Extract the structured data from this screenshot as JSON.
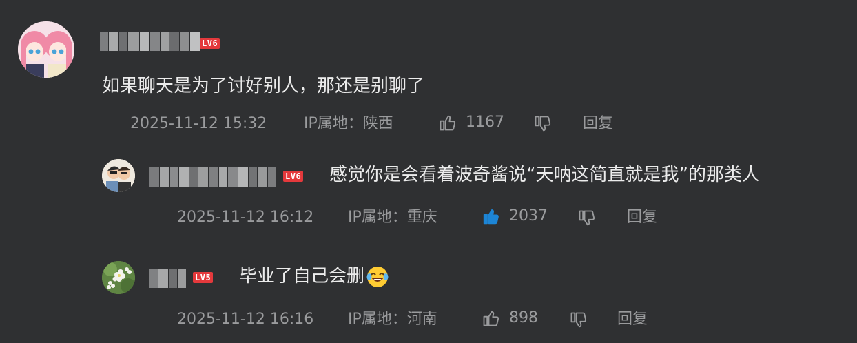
{
  "comments": [
    {
      "username_masked": "",
      "level": "LV6",
      "text": "如果聊天是为了讨好别人，那还是别聊了",
      "time": "2025-11-12 15:32",
      "ip": "IP属地：陕西",
      "likes": "1167",
      "reply": "回复",
      "liked": false
    },
    {
      "username_masked": "",
      "level": "LV6",
      "text": "感觉你是会看着波奇酱说“天呐这简直就是我”的那类人",
      "time": "2025-11-12 16:12",
      "ip": "IP属地：重庆",
      "likes": "2037",
      "reply": "回复",
      "liked": true
    },
    {
      "username_masked": "",
      "level": "LV5",
      "text": "毕业了自己会删",
      "time": "2025-11-12 16:16",
      "ip": "IP属地：河南",
      "likes": "898",
      "reply": "回复",
      "liked": false,
      "emoji": "laughing-tears-emoji"
    }
  ],
  "colors": {
    "background": "#2f3032",
    "level_badge": "#e4393c",
    "liked_thumb": "#1d85d6",
    "meta_text": "#9a9b9d"
  }
}
